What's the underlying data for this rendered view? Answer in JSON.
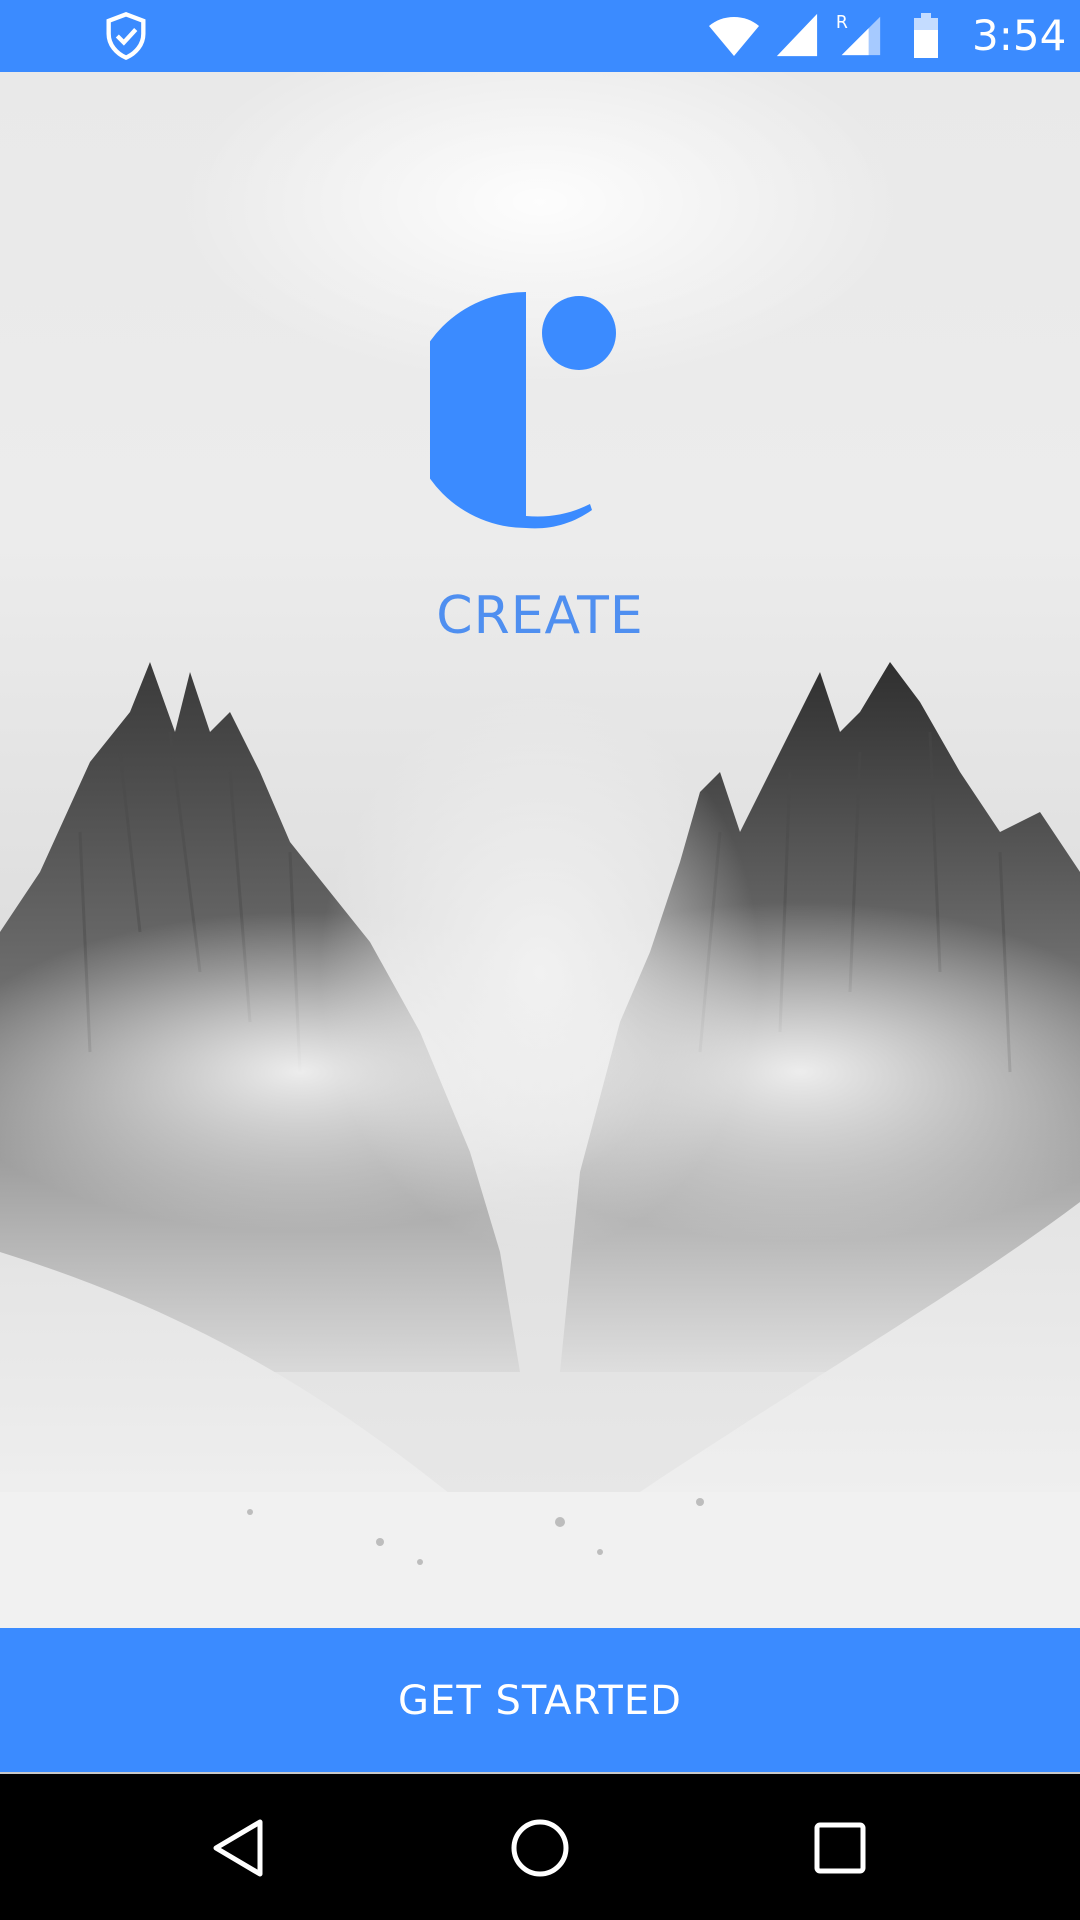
{
  "status_bar": {
    "time": "3:54",
    "icons": [
      "shield-check-icon",
      "wifi-icon",
      "signal-icon",
      "signal-roaming-icon",
      "battery-icon"
    ],
    "roaming_letter": "R",
    "background_color": "#3b8bff"
  },
  "splash": {
    "brand_name": "CREATE",
    "brand_color": "#4f8ff0",
    "background_image": "snowy-mountain-peaks-in-fog"
  },
  "cta": {
    "label": "GET STARTED",
    "background_color": "#3b8bff"
  },
  "nav_bar": {
    "buttons": [
      "back-icon",
      "home-icon",
      "recent-apps-icon"
    ]
  }
}
